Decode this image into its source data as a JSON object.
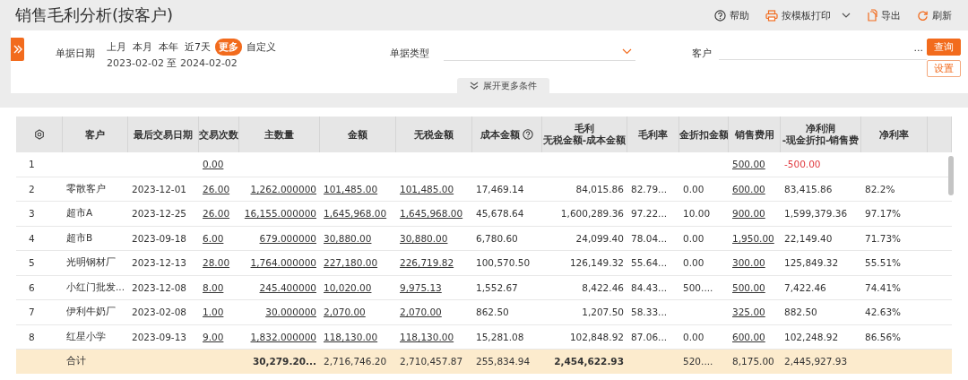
{
  "window": {
    "title": "销售毛利分析(按客户)"
  },
  "toolbar": [
    {
      "kind": "help",
      "label": "帮助"
    },
    {
      "kind": "print",
      "label": "按模板打印"
    },
    {
      "kind": "export",
      "label": "导出"
    },
    {
      "kind": "refresh",
      "label": "刷新"
    }
  ],
  "filters": {
    "date_label": "单据日期",
    "presets": [
      {
        "label": "上月",
        "selected": false
      },
      {
        "label": "本月",
        "selected": false
      },
      {
        "label": "本年",
        "selected": false
      },
      {
        "label": "近7天",
        "selected": false
      },
      {
        "label": "更多",
        "selected": true
      },
      {
        "label": "自定义",
        "selected": false
      }
    ],
    "date_range": "2023-02-02 至 2024-02-02",
    "doc_type_label": "单据类型",
    "customer_label": "客户",
    "customer_more": "...",
    "expand": "展开更多条件",
    "query_button": "查询",
    "settings_button": "设置"
  },
  "table": {
    "columns": [
      {
        "label": "客户",
        "kind": "text"
      },
      {
        "label": "最后交易日期",
        "kind": "text"
      },
      {
        "label": "交易次数",
        "kind": "link"
      },
      {
        "label": "主数量",
        "kind": "link"
      },
      {
        "label": "金额",
        "kind": "link"
      },
      {
        "label": "无税金额",
        "kind": "link"
      },
      {
        "label": "成本金额",
        "kind": "text",
        "help": true
      },
      {
        "label": "毛利",
        "sublabel": "无税金额-成本金额",
        "kind": "text"
      },
      {
        "label": "毛利率",
        "kind": "text"
      },
      {
        "label": "金折扣金额",
        "kind": "text"
      },
      {
        "label": "销售费用",
        "kind": "link"
      },
      {
        "label": "净利润",
        "sublabel": "-现金折扣-销售费",
        "kind": "text"
      },
      {
        "label": "净利率",
        "kind": "text"
      }
    ],
    "rows": [
      {
        "index": "1",
        "net_negative": true,
        "cells": [
          null,
          null,
          "0.00",
          null,
          null,
          null,
          null,
          null,
          null,
          null,
          "500.00",
          "-500.00",
          null
        ]
      },
      {
        "index": "2",
        "net_negative": false,
        "cells": [
          "零散客户",
          "2023-12-01",
          "26.00",
          "1,262.000000",
          "101,485.00",
          "101,485.00",
          "17,469.14",
          "84,015.86",
          "82.79...",
          "0.00",
          "600.00",
          "83,415.86",
          "82.2%"
        ]
      },
      {
        "index": "3",
        "net_negative": false,
        "cells": [
          "超市A",
          "2023-12-25",
          "26.00",
          "16,155.000000",
          "1,645,968.00",
          "1,645,968.00",
          "45,678.64",
          "1,600,289.36",
          "97.22...",
          "10.00",
          "900.00",
          "1,599,379.36",
          "97.17%"
        ]
      },
      {
        "index": "4",
        "net_negative": false,
        "cells": [
          "超市B",
          "2023-09-18",
          "6.00",
          "679.000000",
          "30,880.00",
          "30,880.00",
          "6,780.60",
          "24,099.40",
          "78.04...",
          "0.00",
          "1,950.00",
          "22,149.40",
          "71.73%"
        ]
      },
      {
        "index": "5",
        "net_negative": false,
        "cells": [
          "光明钢材厂",
          "2023-12-13",
          "28.00",
          "1,764.000000",
          "227,180.00",
          "226,719.82",
          "100,570.50",
          "126,149.32",
          "55.64...",
          "0.00",
          "300.00",
          "125,849.32",
          "55.51%"
        ]
      },
      {
        "index": "6",
        "net_negative": false,
        "cells": [
          "小红门批发...",
          "2023-12-08",
          "8.00",
          "245.400000",
          "10,020.00",
          "9,975.13",
          "1,552.67",
          "8,422.46",
          "84.43...",
          "500....",
          "500.00",
          "7,422.46",
          "74.41%"
        ]
      },
      {
        "index": "7",
        "net_negative": false,
        "cells": [
          "伊利牛奶厂",
          "2023-02-08",
          "1.00",
          "30.000000",
          "2,070.00",
          "2,070.00",
          "862.50",
          "1,207.50",
          "58.33...",
          null,
          "325.00",
          "882.50",
          "42.63%"
        ]
      },
      {
        "index": "8",
        "net_negative": false,
        "cells": [
          "红星小学",
          "2023-09-13",
          "9.00",
          "1,832.000000",
          "118,130.00",
          "118,130.00",
          "15,281.08",
          "102,848.92",
          "87.06...",
          "0.00",
          "600.00",
          "102,248.92",
          "86.56%"
        ]
      }
    ],
    "total": {
      "label": "合计",
      "cells": [
        null,
        null,
        {
          "text": "30,279.20...",
          "bold": true
        },
        {
          "text": "2,716,746.20",
          "bold": false
        },
        {
          "text": "2,710,457.87",
          "bold": false
        },
        {
          "text": "255,834.94",
          "bold": false
        },
        {
          "text": "2,454,622.93",
          "bold": true
        },
        null,
        {
          "text": "520....",
          "bold": false
        },
        {
          "text": "8,175.00",
          "bold": false
        },
        {
          "text": "2,445,927.93",
          "bold": false
        },
        null
      ]
    }
  }
}
